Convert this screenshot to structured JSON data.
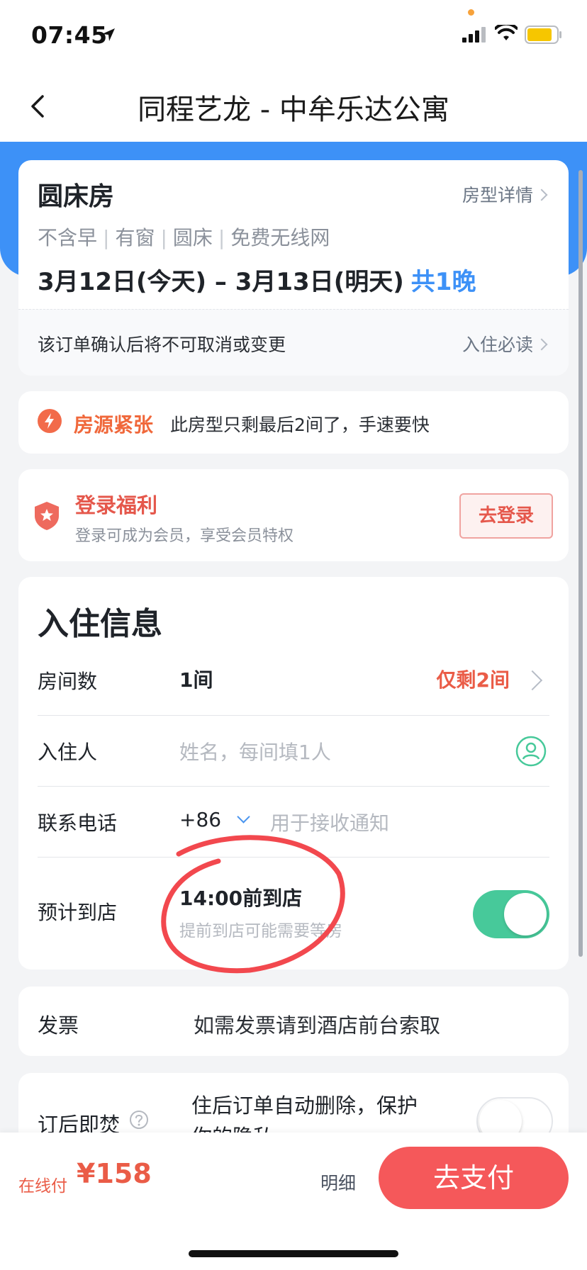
{
  "status_bar": {
    "time": "07:45"
  },
  "nav": {
    "title": "同程艺龙 - 中牟乐达公寓"
  },
  "room": {
    "name": "圆床房",
    "detail_link": "房型详情",
    "tags": [
      "不含早",
      "有窗",
      "圆床",
      "免费无线网"
    ],
    "dates": "3月12日(今天) – 3月13日(明天)",
    "nights": "共1晚",
    "notice": "该订单确认后将不可取消或变更",
    "notice_link": "入住必读"
  },
  "scarce": {
    "title": "房源紧张",
    "text": "此房型只剩最后2间了，手速要快"
  },
  "login": {
    "title": "登录福利",
    "subtitle": "登录可成为会员，享受会员特权",
    "button": "去登录"
  },
  "checkin": {
    "title": "入住信息",
    "rooms_label": "房间数",
    "rooms_value": "1间",
    "rooms_remaining": "仅剩2间",
    "guest_label": "入住人",
    "guest_placeholder": "姓名，每间填1人",
    "phone_label": "联系电话",
    "phone_code": "+86",
    "phone_placeholder": "用于接收通知",
    "arrival_label": "预计到店",
    "arrival_value": "14:00前到店",
    "arrival_note": "提前到店可能需要等房",
    "arrival_toggle_on": true
  },
  "invoice": {
    "label": "发票",
    "value": "如需发票请到酒店前台索取"
  },
  "burn": {
    "label": "订后即焚",
    "description": "住后订单自动删除，保护你的隐私",
    "toggle_on": false
  },
  "bottom": {
    "pay_type": "在线付",
    "price": "¥158",
    "detail": "明细",
    "pay_button": "去支付"
  },
  "colors": {
    "brand_blue": "#3d91f7",
    "accent_red": "#ea5c47",
    "toggle_green": "#47c99a",
    "pay_button": "#f5585a"
  }
}
